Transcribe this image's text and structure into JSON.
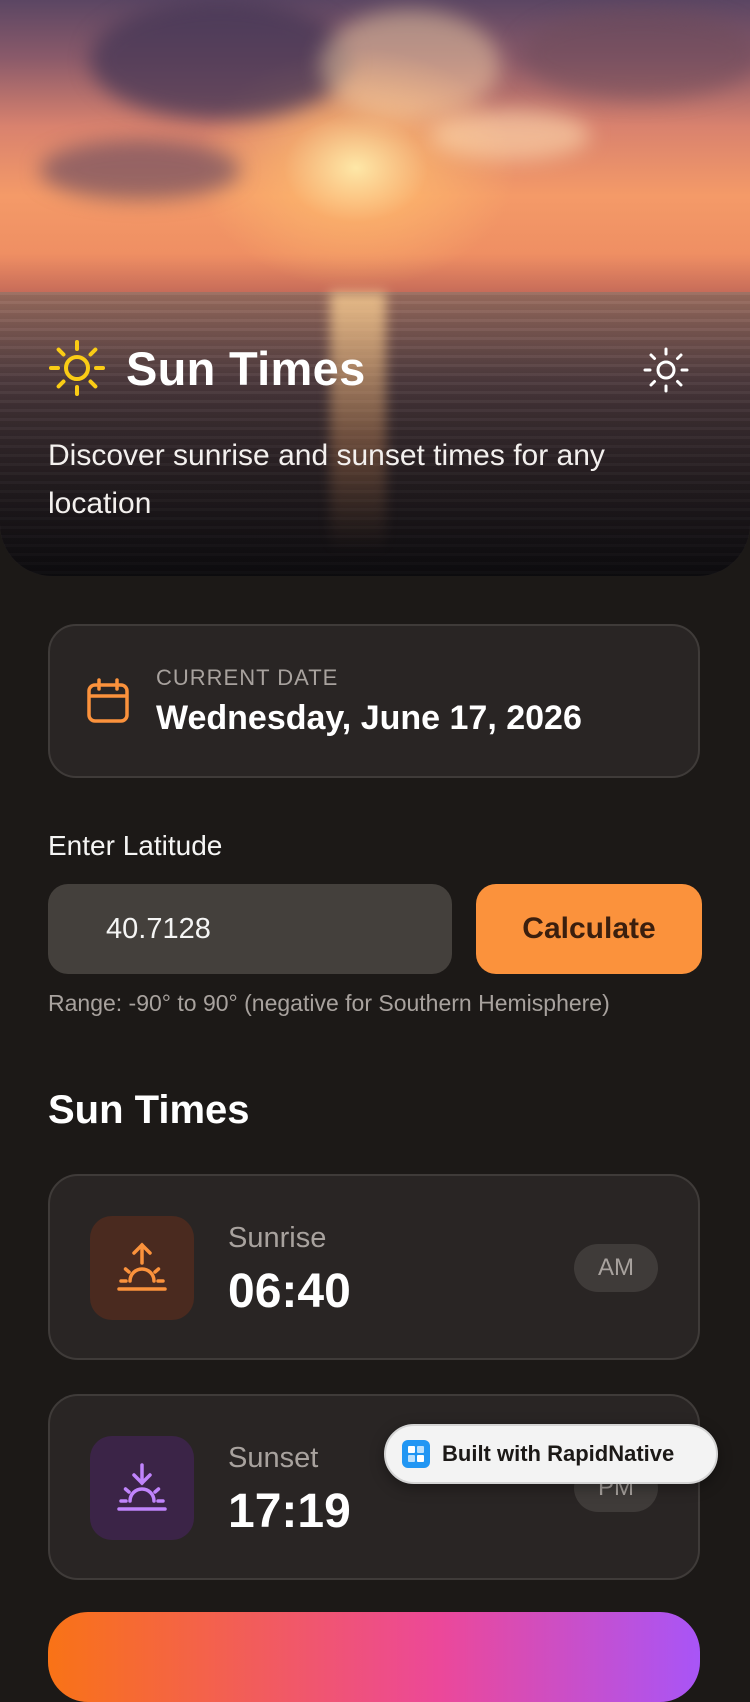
{
  "header": {
    "title": "Sun Times",
    "subtitle": "Discover sunrise and sunset times for any location",
    "logo_icon": "sun-icon",
    "toggle_icon": "sun-outline-icon"
  },
  "date_card": {
    "label": "CURRENT DATE",
    "value": "Wednesday, June 17, 2026",
    "icon": "calendar-icon"
  },
  "latitude": {
    "label": "Enter Latitude",
    "value": "40.7128",
    "button_label": "Calculate",
    "hint": "Range: -90° to 90° (negative for Southern Hemisphere)"
  },
  "sun_times": {
    "title": "Sun Times",
    "sunrise": {
      "label": "Sunrise",
      "time": "06:40",
      "period": "AM",
      "icon": "sunrise-icon"
    },
    "sunset": {
      "label": "Sunset",
      "time": "17:19",
      "period": "PM",
      "icon": "sunset-icon"
    }
  },
  "badge": {
    "text": "Built with RapidNative"
  },
  "colors": {
    "background": "#1c1917",
    "card": "#292524",
    "accent": "#fb923c",
    "sunrise_icon": "#fb923c",
    "sunset_icon": "#c084fc",
    "logo_sun": "#facc15"
  }
}
